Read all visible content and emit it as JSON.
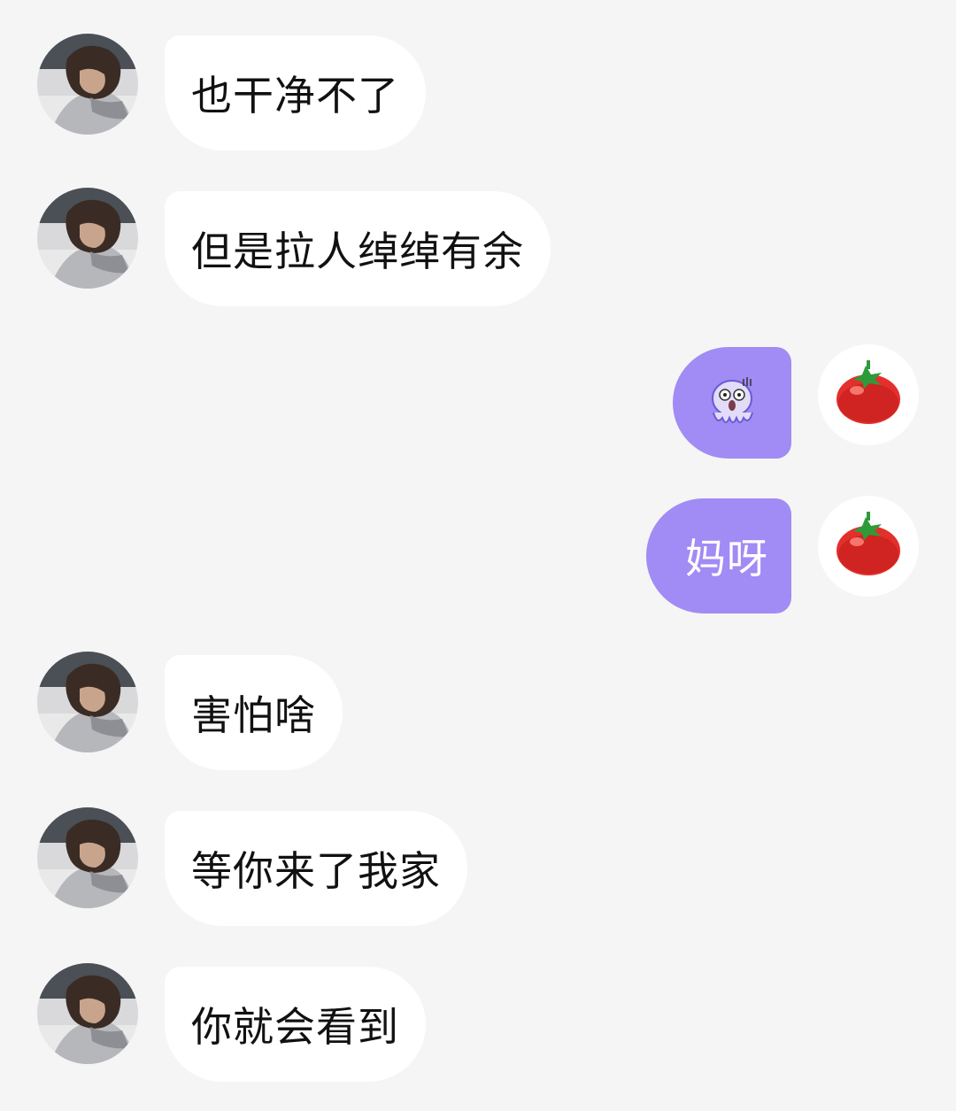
{
  "messages": [
    {
      "side": "incoming",
      "text": "也干净不了"
    },
    {
      "side": "incoming",
      "text": "但是拉人绰绰有余"
    },
    {
      "side": "outgoing",
      "sticker": "scared-octopus-icon"
    },
    {
      "side": "outgoing",
      "text": "妈呀"
    },
    {
      "side": "incoming",
      "text": "害怕啥"
    },
    {
      "side": "incoming",
      "text": "等你来了我家"
    },
    {
      "side": "incoming",
      "text": "你就会看到"
    }
  ],
  "colors": {
    "background": "#f5f5f5",
    "incoming_bubble": "#ffffff",
    "outgoing_bubble": "#a18bf4",
    "incoming_text": "#111111",
    "outgoing_text": "#ffffff"
  },
  "avatars": {
    "contact": "person-photo-avatar",
    "self": "tomato-avatar-icon"
  }
}
